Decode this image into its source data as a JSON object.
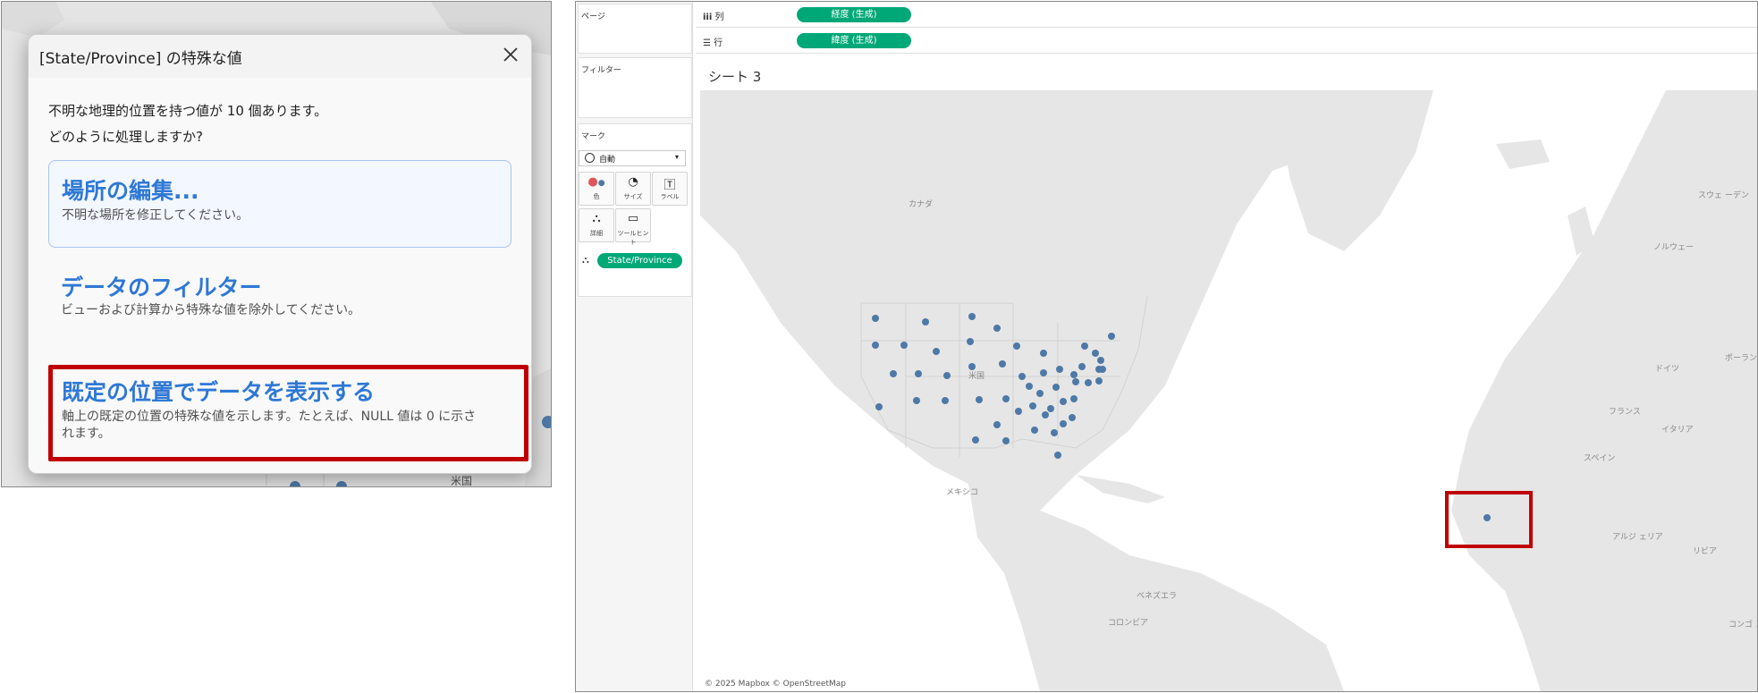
{
  "dialog": {
    "title": "[State/Province] の特殊な値",
    "prompt_line1": "不明な地理的位置を持つ値が 10 個あります。",
    "prompt_line2": "どのように処理しますか?",
    "options": [
      {
        "title": "場所の編集...",
        "desc": "不明な場所を修正してください。"
      },
      {
        "title": "データのフィルター",
        "desc": "ビューおよび計算から特殊な値を除外してください。"
      },
      {
        "title": "既定の位置でデータを表示する",
        "desc_line1": "軸上の既定の位置の特殊な値を示します。たとえば、NULL 値は 0 に示さ",
        "desc_line2": "れます。"
      }
    ],
    "background_map_label": "米国"
  },
  "tableau": {
    "shelves": {
      "pages_label": "ページ",
      "columns_label": "列",
      "rows_label": "行",
      "columns_pill": "経度 (生成)",
      "rows_pill": "緯度 (生成)"
    },
    "filters_label": "フィルター",
    "marks": {
      "label": "マーク",
      "type": "自動",
      "buttons": [
        "色",
        "サイズ",
        "ラベル",
        "詳細",
        "ツールヒント"
      ],
      "detail_pill": "State/Province"
    },
    "sheet_title": "シート 3",
    "map_labels": {
      "canada": "カナダ",
      "usa": "米国",
      "mexico": "メキシコ",
      "venezuela": "ベネズエラ",
      "colombia": "コロンビア",
      "sweden": "スウェ\nーデン",
      "norway": "ノルウェー",
      "poland": "ポーランド",
      "germany": "ドイツ",
      "france": "フランス",
      "italy": "イタリア",
      "spain": "スペイン",
      "algeria": "アルジ\nェリア",
      "libya": "リビア",
      "congo": "コンゴ\nンシャ"
    },
    "attribution": "© 2025 Mapbox © OpenStreetMap"
  },
  "colors": {
    "highlight_box": "#c00000",
    "pill": "#00a878",
    "map_point": "#4e79a7",
    "land": "#e6e6e6",
    "water": "#ffffff",
    "dialog_link": "#2f78d6"
  }
}
